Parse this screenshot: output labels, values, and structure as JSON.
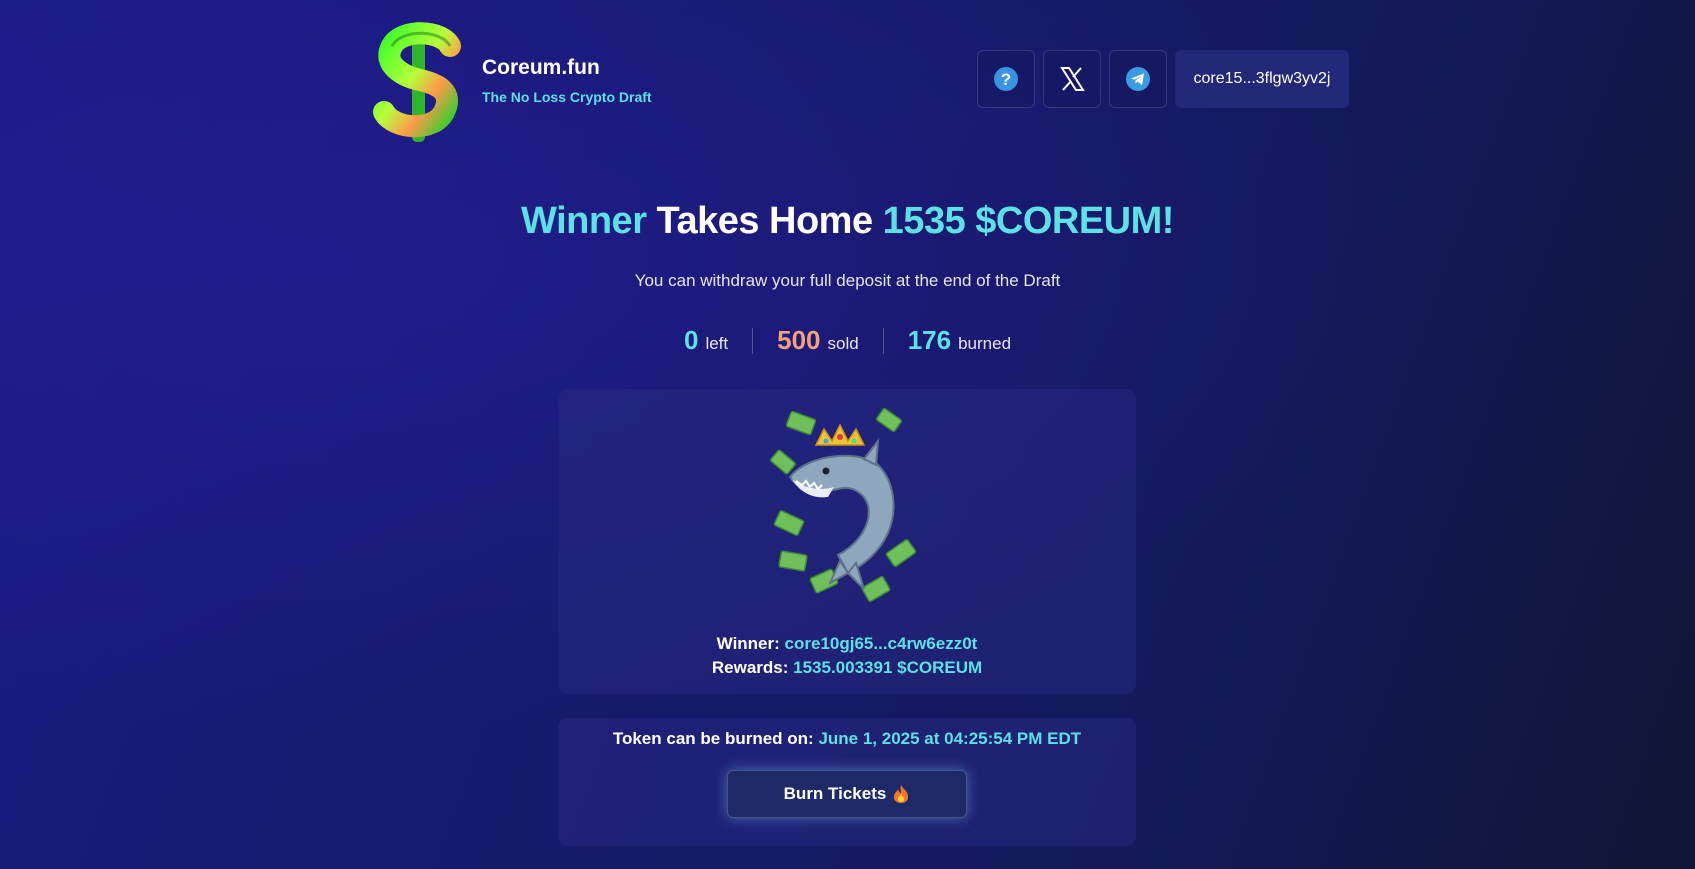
{
  "header": {
    "brand_title": "Coreum.fun",
    "brand_subtitle": "The No Loss Crypto Draft",
    "logo_icon": "dollar-sign-3d-icon",
    "icons": [
      "help-question-icon",
      "x-twitter-icon",
      "telegram-icon"
    ],
    "wallet_address": "core15...3flgw3yv2j"
  },
  "hero": {
    "headline_part1": "Winner",
    "headline_part2": "Takes Home",
    "headline_part3": "1535 $COREUM!",
    "subline": "You can withdraw your full deposit at the end of the Draft"
  },
  "stats": [
    {
      "value": "0",
      "label": "left",
      "color": "#5ce1e6"
    },
    {
      "value": "500",
      "label": "sold",
      "color": "#f4a07a"
    },
    {
      "value": "176",
      "label": "burned",
      "color": "#5ce1e6"
    }
  ],
  "winner": {
    "mascot_icon": "crowned-shark-money-icon",
    "winner_label": "Winner:",
    "winner_address": "core10gj65...c4rw6ezz0t",
    "rewards_label": "Rewards:",
    "rewards_value": "1535.003391 $COREUM"
  },
  "burn": {
    "label": "Token can be burned on:",
    "date": "June 1, 2025 at 04:25:54 PM EDT",
    "button_label": "Burn Tickets",
    "button_icon": "fire-icon"
  },
  "colors": {
    "accent": "#5ce1e6",
    "sold": "#f4a07a",
    "bg_start": "#1c1a86",
    "bg_end": "#101634"
  }
}
